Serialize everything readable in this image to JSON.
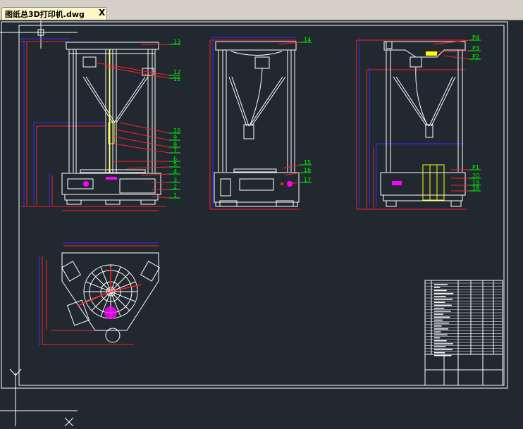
{
  "tab": {
    "title": "图纸总3D打印机.dwg",
    "close_glyph": "X"
  },
  "colors": {
    "background": "#212830",
    "frame": "#ffffff",
    "structure": "#ffffff",
    "dims": "#ff2020",
    "dims_blue": "#3030ff",
    "leader_green": "#00ff00",
    "accent_magenta": "#ff00ff",
    "accent_yellow": "#ffff00"
  },
  "balloons_front": [
    "13",
    "12",
    "11",
    "10",
    "9",
    "8",
    "7",
    "6",
    "5",
    "4",
    "3",
    "2",
    "1"
  ],
  "balloons_side": [
    "14",
    "15",
    "16",
    "17"
  ],
  "balloons_right": [
    "P4",
    "P3",
    "P2",
    "P1",
    "20",
    "19",
    "18"
  ],
  "ucs": {
    "y_label": "Y",
    "x_label": "X"
  }
}
